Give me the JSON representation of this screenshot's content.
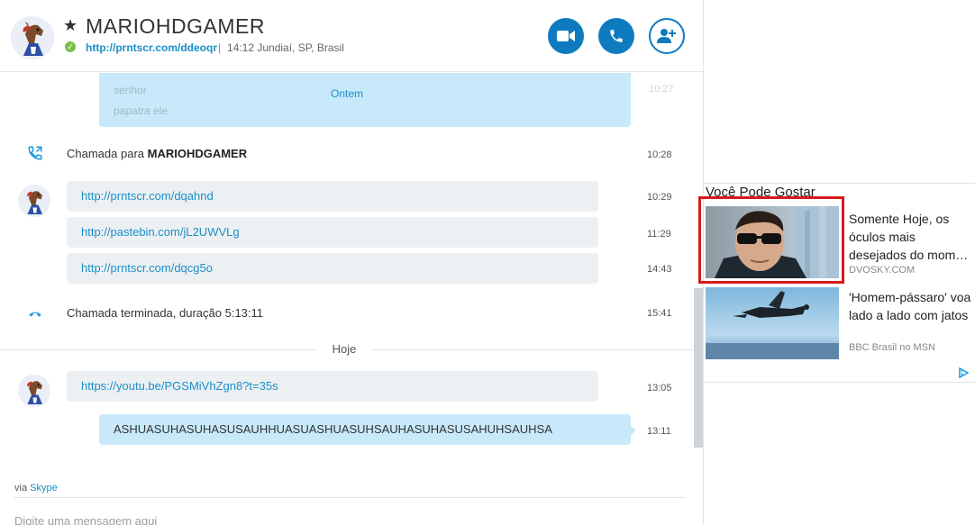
{
  "header": {
    "contact_name": "MARIOHDGAMER",
    "mood_link": "http://prntscr.com/ddeoqr",
    "separator": "|",
    "location": "14:12 Jundiaí, SP, Brasil"
  },
  "conversation": {
    "faded_lines": [
      "senhor",
      "papatra ele"
    ],
    "faded_time": "10:27",
    "day_label_top": "Ontem",
    "call_to": {
      "prefix": "Chamada para ",
      "name": "MARIOHDGAMER",
      "time": "10:28"
    },
    "incoming": [
      {
        "text": "http://prntscr.com/dqahnd",
        "time": "10:29"
      },
      {
        "text": "http://pastebin.com/jL2UWVLg",
        "time": "11:29"
      },
      {
        "text": "http://prntscr.com/dqcg5o",
        "time": "14:43"
      }
    ],
    "call_ended": {
      "text": "Chamada terminada, duração 5:13:11",
      "time": "15:41"
    },
    "day_label_today": "Hoje",
    "today_incoming": {
      "text": "https://youtu.be/PGSMiVhZgn8?t=35s",
      "time": "13:05"
    },
    "today_outgoing": {
      "text": "ASHUASUHASUHASUSAUHHUASUASHUASUHSAUHASUHASUSAHUHSAUHSA",
      "time": "13:11"
    }
  },
  "compose": {
    "via_prefix": "via ",
    "via_link": "Skype",
    "placeholder": "Digite uma mensagem aqui"
  },
  "ads": {
    "heading": "Você Pode Gostar",
    "items": [
      {
        "title": "Somente Hoje, os óculos mais desejados do mom…",
        "source": "DVOSKY.COM"
      },
      {
        "title": "'Homem-pássaro' voa lado a lado com jatos",
        "source": "BBC Brasil no MSN"
      }
    ]
  },
  "colors": {
    "accent": "#0e7bbf",
    "link": "#1a8fc9",
    "outgoing_bubble": "#c7e9fa",
    "incoming_bubble": "#edf0f2",
    "online": "#7cc04b",
    "highlight": "#d9191c"
  }
}
